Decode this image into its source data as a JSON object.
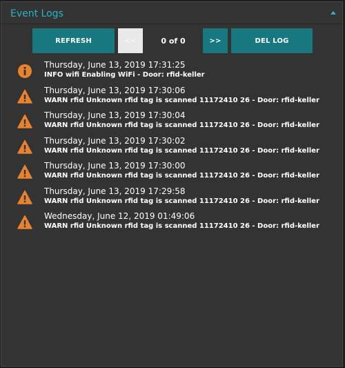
{
  "panel": {
    "title": "Event Logs",
    "accent_color": "#27b5c8",
    "collapse_icon": "chevron-up-icon"
  },
  "toolbar": {
    "refresh_label": "REFRESH",
    "prev_label": "<<",
    "counter": "0 of 0",
    "next_label": ">>",
    "delete_label": "DEL LOG",
    "button_color": "#17787f"
  },
  "logs": [
    {
      "level": "info",
      "icon": "info-icon",
      "time": "Thursday, June 13, 2019 17:31:25",
      "message": "INFO wifi Enabling WiFi - Door: rfid-keller"
    },
    {
      "level": "warn",
      "icon": "warning-icon",
      "time": "Thursday, June 13, 2019 17:30:06",
      "message": "WARN rfid Unknown rfid tag is scanned 11172410 26 - Door: rfid-keller"
    },
    {
      "level": "warn",
      "icon": "warning-icon",
      "time": "Thursday, June 13, 2019 17:30:04",
      "message": "WARN rfid Unknown rfid tag is scanned 11172410 26 - Door: rfid-keller"
    },
    {
      "level": "warn",
      "icon": "warning-icon",
      "time": "Thursday, June 13, 2019 17:30:02",
      "message": "WARN rfid Unknown rfid tag is scanned 11172410 26 - Door: rfid-keller"
    },
    {
      "level": "warn",
      "icon": "warning-icon",
      "time": "Thursday, June 13, 2019 17:30:00",
      "message": "WARN rfid Unknown rfid tag is scanned 11172410 26 - Door: rfid-keller"
    },
    {
      "level": "warn",
      "icon": "warning-icon",
      "time": "Thursday, June 13, 2019 17:29:58",
      "message": "WARN rfid Unknown rfid tag is scanned 11172410 26 - Door: rfid-keller"
    },
    {
      "level": "warn",
      "icon": "warning-icon",
      "time": "Wednesday, June 12, 2019 01:49:06",
      "message": "WARN rfid Unknown rfid tag is scanned 11172410 26 - Door: rfid-keller"
    }
  ],
  "icon_color": "#e8822e"
}
